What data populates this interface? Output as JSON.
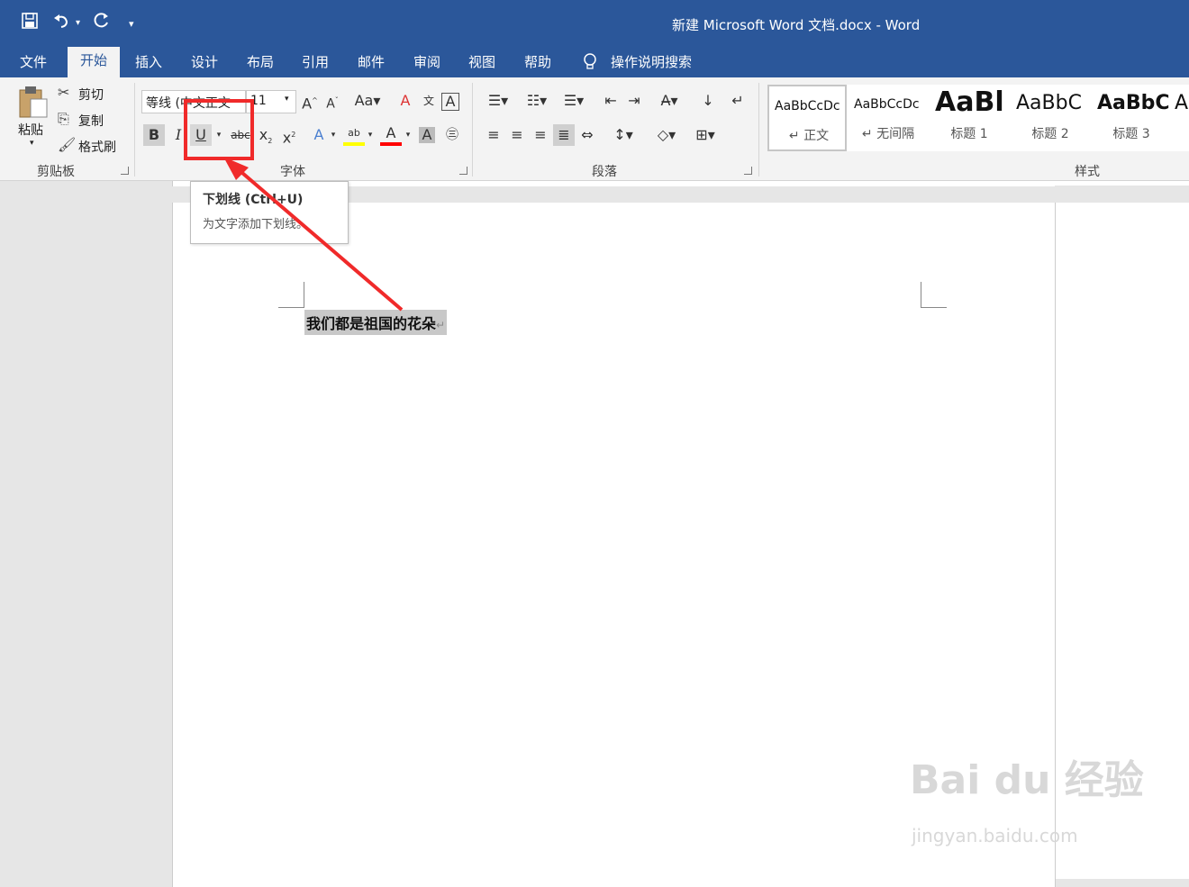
{
  "window": {
    "title": "新建 Microsoft Word 文档.docx  -  Word"
  },
  "quick_access": {
    "save_icon": "save-icon",
    "undo_icon": "undo-icon",
    "redo_icon": "redo-icon",
    "customize_icon": "customize-icon"
  },
  "tabs": [
    {
      "label": "文件"
    },
    {
      "label": "开始",
      "active": true
    },
    {
      "label": "插入"
    },
    {
      "label": "设计"
    },
    {
      "label": "布局"
    },
    {
      "label": "引用"
    },
    {
      "label": "邮件"
    },
    {
      "label": "审阅"
    },
    {
      "label": "视图"
    },
    {
      "label": "帮助"
    }
  ],
  "tell_me": {
    "label": "操作说明搜索"
  },
  "clipboard": {
    "paste": "粘贴",
    "cut": "剪切",
    "copy": "复制",
    "format_painter": "格式刷",
    "group_label": "剪贴板"
  },
  "font": {
    "name": "等线 (中文正文",
    "size": "11",
    "group_label": "字体"
  },
  "paragraph": {
    "group_label": "段落"
  },
  "styles": {
    "items": [
      {
        "sample": "AaBbCcDc",
        "name": "↵ 正文"
      },
      {
        "sample": "AaBbCcDc",
        "name": "↵ 无间隔"
      },
      {
        "sample": "AaBl",
        "name": "标题 1"
      },
      {
        "sample": "AaBbC",
        "name": "标题 2"
      },
      {
        "sample": "AaBbC",
        "name": "标题 3"
      },
      {
        "sample": "A",
        "name": ""
      }
    ],
    "group_label": "样式"
  },
  "tooltip": {
    "title": "下划线 (Ctrl+U)",
    "description": "为文字添加下划线。"
  },
  "document": {
    "text": "我们都是祖国的花朵"
  },
  "watermark": {
    "brand": "Bai du 经验",
    "url": "jingyan.baidu.com"
  },
  "colors": {
    "accent": "#2b579a",
    "annotation": "#f02a2a",
    "highlight": "#ffff00",
    "font_color": "#ff0000"
  }
}
